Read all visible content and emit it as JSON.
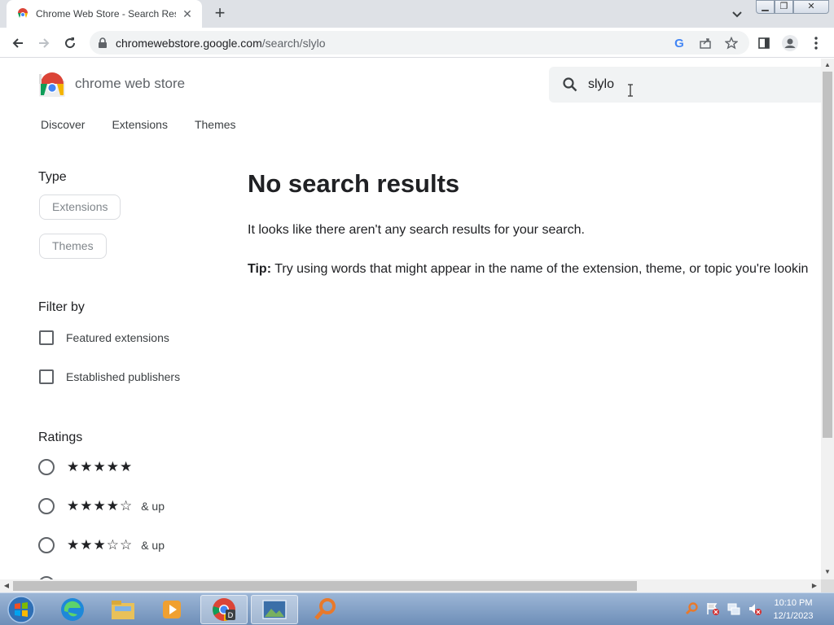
{
  "browser": {
    "tab_title": "Chrome Web Store - Search Results",
    "url_host": "chromewebstore.google.com",
    "url_path": "/search/slylo"
  },
  "page": {
    "brand": "chrome web store",
    "search_value": "slylo",
    "nav": [
      "Discover",
      "Extensions",
      "Themes"
    ],
    "type_heading": "Type",
    "type_chips": [
      "Extensions",
      "Themes"
    ],
    "filter_heading": "Filter by",
    "filters": [
      "Featured extensions",
      "Established publishers"
    ],
    "ratings_heading": "Ratings",
    "ratings": [
      {
        "stars": "★★★★★",
        "suffix": ""
      },
      {
        "stars": "★★★★☆",
        "suffix": "& up"
      },
      {
        "stars": "★★★☆☆",
        "suffix": "& up"
      }
    ],
    "no_results_title": "No search results",
    "no_results_message": "It looks like there aren't any search results for your search.",
    "tip_label": "Tip:",
    "tip_text": " Try using words that might appear in the name of the extension, theme, or topic you're lookin"
  },
  "taskbar": {
    "time": "10:10 PM",
    "date": "12/1/2023"
  },
  "colors": {
    "accent": "#1a73e8",
    "text": "#202124",
    "muted": "#5f6368"
  }
}
